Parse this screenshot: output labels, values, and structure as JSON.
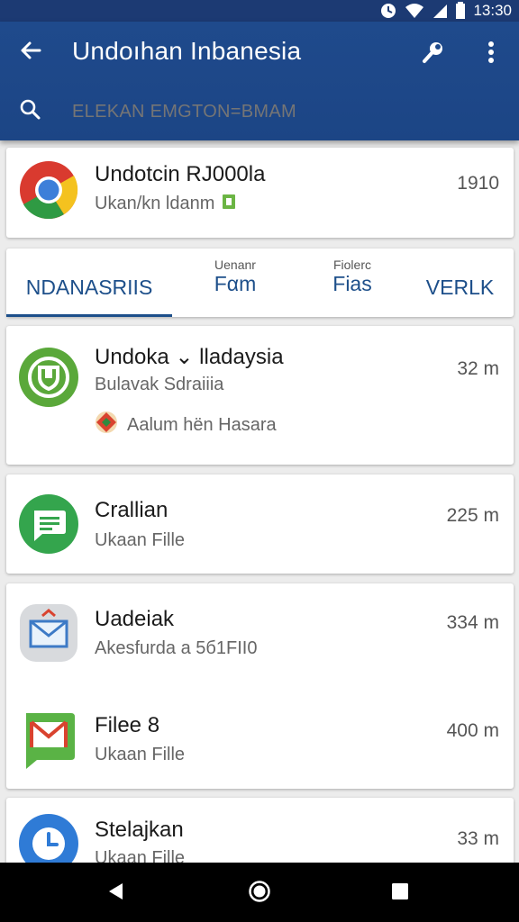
{
  "status_bar": {
    "time": "13:30"
  },
  "app_bar": {
    "title": "Undoıhan Inbanesia",
    "search_placeholder": "ELEKAN EMGTON=BMAM"
  },
  "top_item": {
    "title": "Undotcin RJ000la",
    "subtitle": "Ukan/kn ldanm",
    "meta": "1910"
  },
  "tabs": [
    {
      "label": "NDANASRIIS",
      "small": ""
    },
    {
      "label": "Fαm",
      "small": "Uenanr"
    },
    {
      "label": "Fias",
      "small": "Fiolerc"
    },
    {
      "label": "VERLK",
      "small": ""
    }
  ],
  "list_items": [
    {
      "title": "Undoka ⌄ lladaysia",
      "subtitle": "Bulavak Sdraiiia",
      "note": "Aalum hën Hasara",
      "meta": "32 m"
    },
    {
      "title": "Crallian",
      "subtitle": "Ukaan Fille",
      "meta": "225 m"
    },
    {
      "title": "Uadeiak",
      "subtitle": "Akesfurda a 5б1FII0",
      "meta": "334 m"
    },
    {
      "title": "Filee 8",
      "subtitle": "Ukaan Fille",
      "meta": "400 m"
    },
    {
      "title": "Stelajkan",
      "subtitle": "Ukaan Fille",
      "meta": "33 m"
    }
  ],
  "colors": {
    "app_bar": "#1f4a8c",
    "accent": "#1d4f8a",
    "status_bar": "#1c3a73"
  },
  "icons": {
    "top_item": "chrome-icon",
    "item_1": "shield-app-icon",
    "item_2": "message-app-icon",
    "item_3": "email-app-icon",
    "item_4": "gmail-app-icon",
    "item_5": "clock-app-icon"
  }
}
